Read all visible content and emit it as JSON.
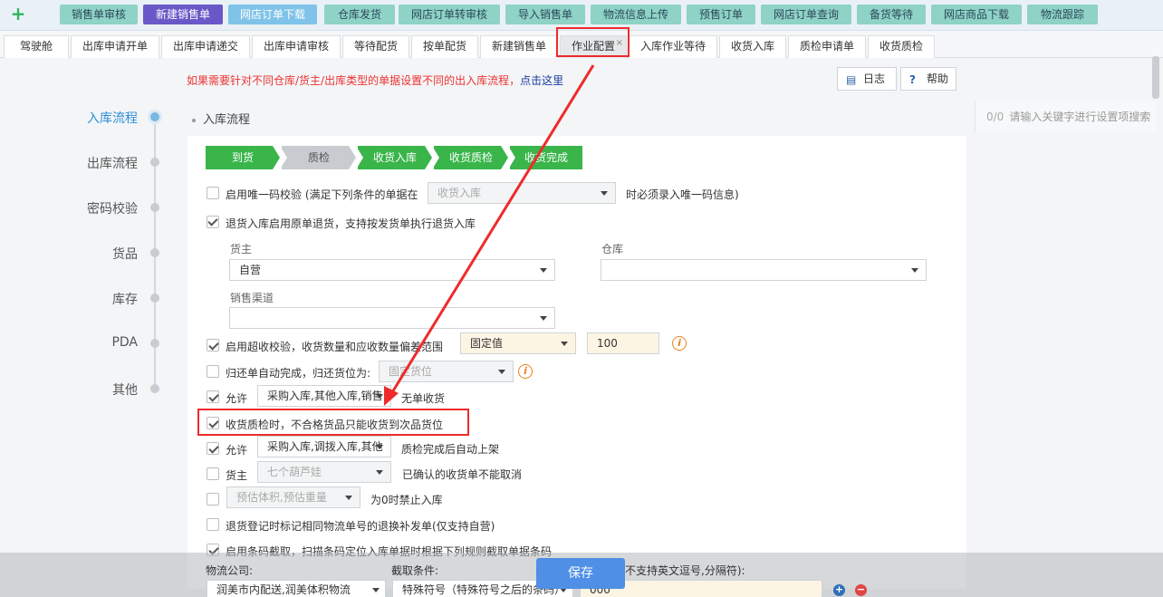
{
  "toolbar": {
    "plus_icon": "+",
    "buttons": [
      "销售单审核",
      "新建销售单",
      "网店订单下载",
      "仓库发货",
      "网店订单转审核",
      "导入销售单",
      "物流信息上传",
      "预售订单",
      "网店订单查询",
      "备货等待",
      "网店商品下载",
      "物流跟踪"
    ]
  },
  "tabs": [
    "驾驶舱",
    "出库申请开单",
    "出库申请递交",
    "出库申请审核",
    "等待配货",
    "按单配货",
    "新建销售单",
    "作业配置",
    "入库作业等待",
    "收货入库",
    "质检申请单",
    "收货质检"
  ],
  "tab_close": "×",
  "notice": {
    "text": "如果需要针对不同仓库/货主/出库类型的单据设置不同的出入库流程，",
    "link": "点击这里"
  },
  "log_button": "日志",
  "help_button": "帮助",
  "search": {
    "count": "0/0",
    "placeholder": "请输入关键字进行设置项搜索"
  },
  "nav": [
    "入库流程",
    "出库流程",
    "密码校验",
    "货品",
    "库存",
    "PDA",
    "其他"
  ],
  "section_title": "入库流程",
  "flow_steps": [
    "到货",
    "质检",
    "收货入库",
    "收货质检",
    "收货完成"
  ],
  "form": {
    "unique_code_label": "启用唯一码校验 (满足下列条件的单据在",
    "unique_code_select": "收货入库",
    "unique_code_suffix": "时必须录入唯一码信息)",
    "return_label": "退货入库启用原单退货，支持按发货单执行退货入库",
    "owner_label": "货主",
    "owner_value": "自营",
    "warehouse_label": "仓库",
    "warehouse_value": "",
    "channel_label": "销售渠道",
    "channel_value": "",
    "overcheck_label": "启用超收校验，收货数量和应收数量偏差范围",
    "overcheck_select": "固定值",
    "overcheck_value": "100",
    "return_auto_label": "归还单自动完成，归还货位为:",
    "return_auto_select": "固定货位",
    "allow_label": "允许",
    "allow_select": "采购入库,其他入库,销售",
    "allow_suffix": "无单收货",
    "qc_label": "收货质检时，不合格货品只能收货到次品货位",
    "allow2_label": "允许",
    "allow2_select": "采购入库,调拨入库,其他",
    "allow2_suffix": "质检完成后自动上架",
    "owner2_label": "货主",
    "owner2_select": "七个葫芦娃",
    "owner2_suffix": "已确认的收货单不能取消",
    "estimate_select": "预估体积,预估重量",
    "estimate_suffix": "为0时禁止入库",
    "return_reg_label": "退货登记时标记相同物流单号的退换补发单(仅支持自营)",
    "barcode_label": "启用条码截取，扫描条码定位入库单据时根据下列规则截取单据条码"
  },
  "footer": {
    "logistics_label": "物流公司:",
    "logistics_value": "润美市内配送,润美体积物流",
    "cut_label": "截取条件:",
    "cut_value": "特殊符号（特殊符号之后的条码）",
    "note": "不支持英文逗号,分隔符):",
    "code_value": "000",
    "save": "保存"
  },
  "colors": {
    "accent": "#39b54a",
    "highlight": "#ee2b2b",
    "link": "#1a3a9e",
    "save": "#4f8fe6"
  }
}
